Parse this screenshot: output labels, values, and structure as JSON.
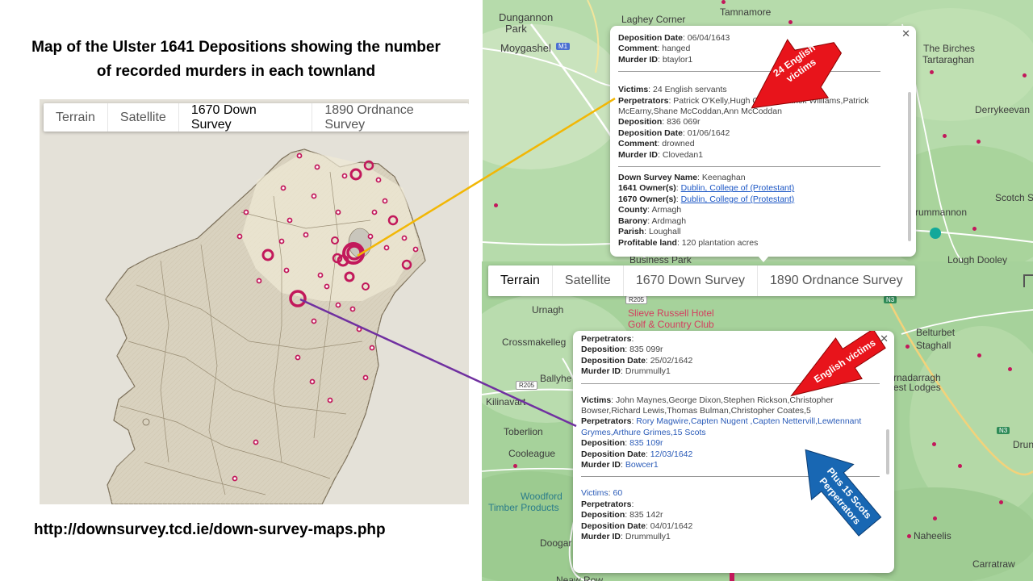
{
  "slide": {
    "title": "Map of the Ulster 1641 Depositions showing the number of recorded murders in each townland",
    "url": "http://downsurvey.tcd.ie/down-survey-maps.php"
  },
  "map_types": [
    "Terrain",
    "Satellite",
    "1670 Down Survey",
    "1890 Ordnance Survey"
  ],
  "left_map": {
    "active_type": "1670 Down Survey"
  },
  "top_map": {
    "places": [
      "Dungannon",
      "Park",
      "Laghey Corner",
      "Tamnamore",
      "Moygashel",
      "The Birches",
      "Tartaraghan",
      "Derrykeevan",
      "Scotch S",
      "rummannon",
      "Business Park",
      "Lough Dooley"
    ],
    "road_badges": [
      "M1"
    ],
    "popup": {
      "top_fields": [
        {
          "label": "Deposition Date",
          "value": "06/04/1643"
        },
        {
          "label": "Comment",
          "value": "hanged"
        },
        {
          "label": "Murder ID",
          "value": "btaylor1"
        }
      ],
      "victim_fields": [
        {
          "label": "Victims",
          "value": "24 English servants"
        },
        {
          "label": "Perpetrators",
          "value": "Patrick O'Kelly,Hugh O'Kelly,Patrick Williams,Patrick McEarny,Shane McCoddan,Ann McCoddan"
        },
        {
          "label": "Deposition",
          "value": "836 069r"
        },
        {
          "label": "Deposition Date",
          "value": "01/06/1642"
        },
        {
          "label": "Comment",
          "value": "drowned"
        },
        {
          "label": "Murder ID",
          "value": "Clovedan1"
        }
      ],
      "survey_fields": [
        {
          "label": "Down Survey Name",
          "value": "Keenaghan"
        },
        {
          "label": "1641 Owner(s)",
          "value": "Dublin, College of (Protestant)",
          "link": true
        },
        {
          "label": "1670 Owner(s)",
          "value": "Dublin, College of (Protestant)",
          "link": true
        },
        {
          "label": "County",
          "value": "Armagh"
        },
        {
          "label": "Barony",
          "value": "Ardmagh"
        },
        {
          "label": "Parish",
          "value": "Loughall"
        },
        {
          "label": "Profitable land",
          "value": "120 plantation acres"
        }
      ]
    }
  },
  "bottom_map": {
    "active_type": "Terrain",
    "places": [
      "Urnagh",
      "Slieve Russell Hotel",
      "Golf & Country Club",
      "Crossmakelleg",
      "Ballyhe",
      "Kilinavart",
      "Toberlion",
      "Cooleague",
      "Woodford",
      "Timber Products",
      "Doogar",
      "Belturbet",
      "Staghall",
      "rnadarragh",
      "est Lodges",
      "Drun",
      "Naheelis",
      "Carratraw",
      "Neaw Row"
    ],
    "road_badges": [
      "R205",
      "R205",
      "N3",
      "N3"
    ],
    "popup": {
      "first_fields": [
        {
          "label": "Perpetrators",
          "value": ""
        },
        {
          "label": "Deposition",
          "value": "835 099r"
        },
        {
          "label": "Deposition Date",
          "value": "25/02/1642"
        },
        {
          "label": "Murder ID",
          "value": "Drummully1"
        }
      ],
      "second_fields": [
        {
          "label": "Victims",
          "value": "John Maynes,George Dixon,Stephen Rickson,Christopher Bowser,Richard Lewis,Thomas Bulman,Christopher Coates,5"
        },
        {
          "label": "Perpetrators",
          "value": "Rory Magwire,Capten Nugent ,Capten Nettervill,Lewtennant Grymes,Arthure Grimes,15 Scots"
        },
        {
          "label": "Deposition",
          "value": "835 109r"
        },
        {
          "label": "Deposition Date",
          "value": "12/03/1642"
        },
        {
          "label": "Murder ID",
          "value": "Bowcer1"
        }
      ],
      "third_fields": [
        {
          "label": "Victims",
          "value": "60"
        },
        {
          "label": "Perpetrators",
          "value": ""
        },
        {
          "label": "Deposition",
          "value": "835 142r"
        },
        {
          "label": "Deposition Date",
          "value": "04/01/1642"
        },
        {
          "label": "Murder ID",
          "value": "Drummully1"
        }
      ]
    }
  },
  "callouts": {
    "top_red": "24 English victims",
    "bottom_red": "English victims",
    "blue": "Plus 15 Scots Perpetrators"
  },
  "colors": {
    "red_arrow": "#e8141b",
    "blue_arrow": "#1867b3",
    "gold_line": "#f2b705",
    "purple_line": "#7030a0",
    "marker": "#c2185b",
    "terrain_green": "#a8d3a1"
  },
  "icons": [
    "close-icon",
    "fullscreen-icon",
    "marker-pin-icon",
    "park-icon"
  ]
}
